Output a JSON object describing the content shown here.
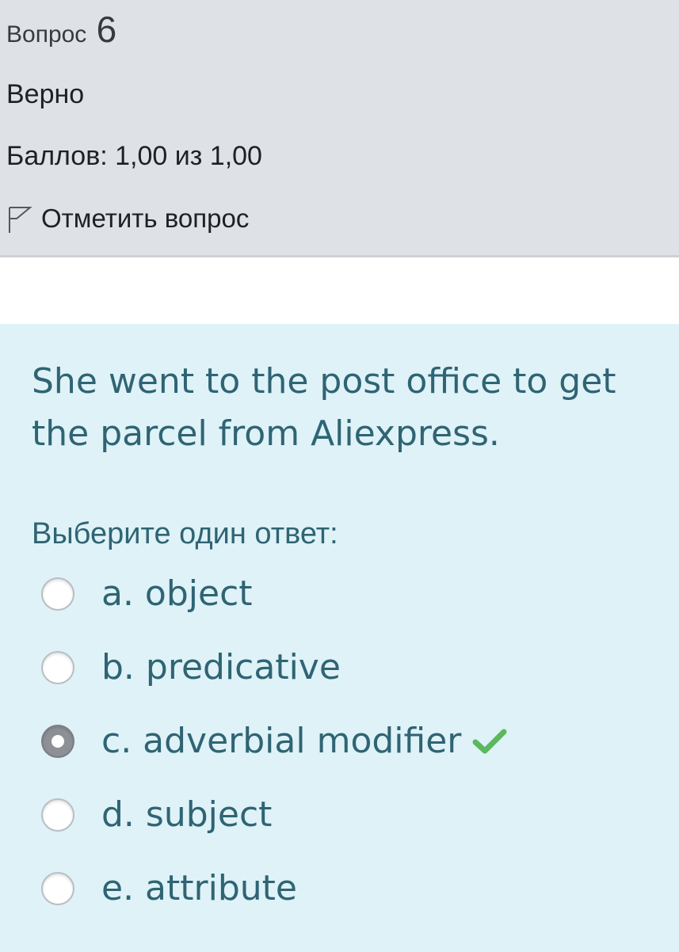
{
  "info": {
    "question_word": "Вопрос",
    "question_number": "6",
    "state": "Верно",
    "grade": "Баллов: 1,00 из 1,00",
    "flag_label": "Отметить вопрос"
  },
  "question": {
    "text": "She went to the post office to get the parcel from Aliexpress.",
    "prompt": "Выберите один ответ:",
    "options": [
      {
        "label": "a. object",
        "selected": false,
        "correct": false
      },
      {
        "label": "b. predicative",
        "selected": false,
        "correct": false
      },
      {
        "label": "c. adverbial modifier",
        "selected": true,
        "correct": true
      },
      {
        "label": "d. subject",
        "selected": false,
        "correct": false
      },
      {
        "label": "e. attribute",
        "selected": false,
        "correct": false
      }
    ]
  },
  "colors": {
    "info_bg": "#dee2e6",
    "content_bg": "#def2f8",
    "text_teal": "#2f6473",
    "check_green": "#5cb85c"
  },
  "icons": {
    "flag": "flag-icon",
    "check": "check-icon"
  }
}
